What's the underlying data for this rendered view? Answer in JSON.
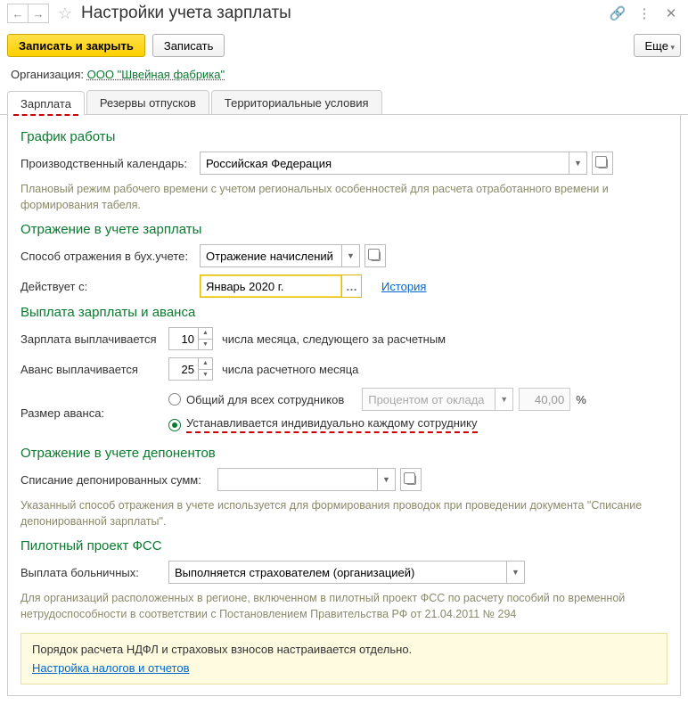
{
  "header": {
    "title": "Настройки учета зарплаты"
  },
  "actions": {
    "write_close": "Записать и закрыть",
    "write": "Записать",
    "more": "Еще"
  },
  "org": {
    "label": "Организация:",
    "value": "ООО \"Швейная фабрика\""
  },
  "tabs": [
    {
      "label": "Зарплата"
    },
    {
      "label": "Резервы отпусков"
    },
    {
      "label": "Территориальные условия"
    }
  ],
  "sections": {
    "schedule": {
      "title": "График работы",
      "calendar_label": "Производственный календарь:",
      "calendar_value": "Российская Федерация",
      "hint": "Плановый режим рабочего времени с учетом региональных особенностей для расчета отработанного времени и формирования табеля."
    },
    "accounting": {
      "title": "Отражение в учете зарплаты",
      "method_label": "Способ отражения в бух.учете:",
      "method_value": "Отражение начислений по",
      "valid_from_label": "Действует с:",
      "valid_from_value": "Январь 2020 г.",
      "history_link": "История"
    },
    "payment": {
      "title": "Выплата зарплаты и аванса",
      "salary_label": "Зарплата выплачивается",
      "salary_day": "10",
      "salary_suffix": "числа месяца, следующего за расчетным",
      "advance_label": "Аванс выплачивается",
      "advance_day": "25",
      "advance_suffix": "числа расчетного месяца",
      "size_label": "Размер аванса:",
      "opt_common": "Общий для всех сотрудников",
      "opt_individual": "Устанавливается индивидуально каждому сотруднику",
      "percent_combo": "Процентом от оклада",
      "percent_value": "40,00",
      "percent_sign": "%"
    },
    "deponents": {
      "title": "Отражение в учете депонентов",
      "writeoff_label": "Списание депонированных сумм:",
      "hint": "Указанный способ отражения в учете используется для формирования проводок при проведении документа \"Списание депонированной зарплаты\"."
    },
    "fss": {
      "title": "Пилотный проект ФСС",
      "label": "Выплата больничных:",
      "value": "Выполняется страхователем (организацией)",
      "hint": "Для организаций расположенных в регионе, включенном в пилотный проект ФСС по расчету пособий по временной нетрудоспособности в соответствии с Постановлением Правительства РФ от 21.04.2011 № 294"
    },
    "infobox": {
      "text": "Порядок расчета НДФЛ и страховых взносов настраивается отдельно.",
      "link": "Настройка налогов и отчетов"
    }
  }
}
